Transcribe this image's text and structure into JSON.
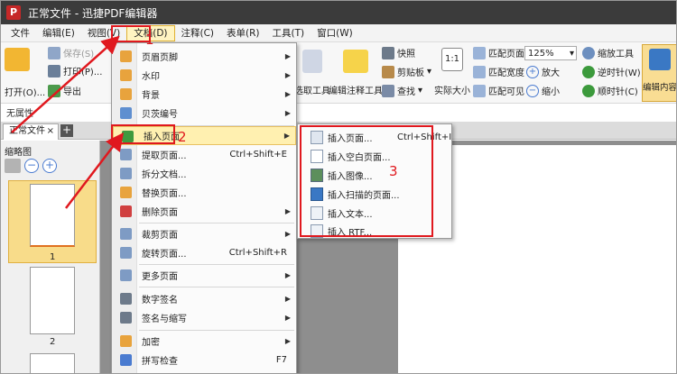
{
  "window": {
    "title": "正常文件 - 迅捷PDF编辑器",
    "logo": "P"
  },
  "menubar": [
    {
      "label": "文件"
    },
    {
      "label": "编辑(E)"
    },
    {
      "label": "视图(V)"
    },
    {
      "label": "文档(D)"
    },
    {
      "label": "注释(C)"
    },
    {
      "label": "表单(R)"
    },
    {
      "label": "工具(T)"
    },
    {
      "label": "窗口(W)"
    }
  ],
  "ribbon": {
    "open": "打开(O)...",
    "save": "保存(S)",
    "print": "打印(P)...",
    "export": "导出",
    "select_tool": "选取工具",
    "edit_anno_tool": "编辑注释工具",
    "snapshot": "快照",
    "clipboard": "剪贴板",
    "find": "查找",
    "actual_size": "实际大小",
    "actual_size_glyph": "1:1",
    "fit_page": "匹配页面",
    "fit_width": "匹配宽度",
    "fit_visible": "匹配可见",
    "zoom_value": "125%",
    "zoom_tool": "缩放工具",
    "zoom_in": "放大",
    "zoom_out": "缩小",
    "rotate_ccw": "逆时针(W)",
    "rotate_cw": "顺时针(C)",
    "edit_content": "编辑内容"
  },
  "properties_label": "无属性",
  "tab": {
    "name": "正常文件",
    "close": "×",
    "add": "+"
  },
  "thumbnails": {
    "title": "缩略图",
    "zoom_out": "−",
    "zoom_in": "+",
    "pages": [
      "1",
      "2"
    ]
  },
  "doc_menu": {
    "items": [
      {
        "label": "页眉页脚",
        "shortcut": "",
        "submenu": true
      },
      {
        "label": "水印",
        "shortcut": "",
        "submenu": true
      },
      {
        "label": "背景",
        "shortcut": "",
        "submenu": true
      },
      {
        "label": "贝茨编号",
        "shortcut": "",
        "submenu": true
      },
      {
        "label": "插入页面",
        "shortcut": "",
        "submenu": true,
        "highlighted": true
      },
      {
        "label": "提取页面...",
        "shortcut": "Ctrl+Shift+E",
        "submenu": false
      },
      {
        "label": "拆分文档...",
        "shortcut": "",
        "submenu": false
      },
      {
        "label": "替换页面...",
        "shortcut": "",
        "submenu": false
      },
      {
        "label": "删除页面",
        "shortcut": "",
        "submenu": true
      },
      {
        "label": "裁剪页面",
        "shortcut": "",
        "submenu": true
      },
      {
        "label": "旋转页面...",
        "shortcut": "Ctrl+Shift+R",
        "submenu": false
      },
      {
        "label": "更多页面",
        "shortcut": "",
        "submenu": true
      },
      {
        "label": "数字签名",
        "shortcut": "",
        "submenu": true
      },
      {
        "label": "签名与缩写",
        "shortcut": "",
        "submenu": true
      },
      {
        "label": "加密",
        "shortcut": "",
        "submenu": true
      },
      {
        "label": "拼写检查",
        "shortcut": "F7",
        "submenu": false
      }
    ]
  },
  "insert_submenu": {
    "items": [
      {
        "label": "插入页面...",
        "shortcut": "Ctrl+Shift+I"
      },
      {
        "label": "插入空白页面...",
        "shortcut": ""
      },
      {
        "label": "插入图像...",
        "shortcut": ""
      },
      {
        "label": "插入扫描的页面...",
        "shortcut": ""
      },
      {
        "label": "插入文本...",
        "shortcut": ""
      },
      {
        "label": "插入 RTF...",
        "shortcut": ""
      }
    ]
  },
  "annotations": {
    "step1": "1",
    "step2": "2",
    "step3": "3"
  },
  "colors": {
    "annotation_red": "#e0181e",
    "highlight": "#fff0b0",
    "titlebar": "#3b3b3b"
  }
}
